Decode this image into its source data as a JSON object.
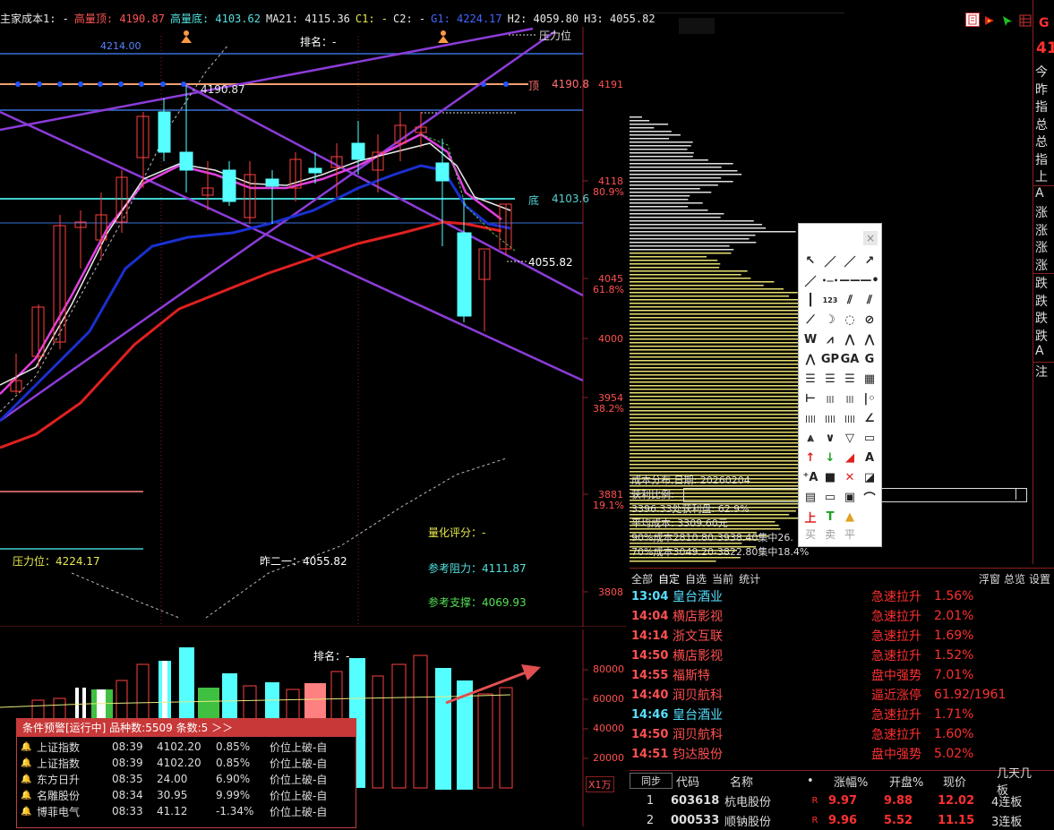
{
  "header": {
    "items": [
      {
        "text": "主家成本1: -",
        "color": "#e8e8e8"
      },
      {
        "text": "高量顶: 4190.87",
        "color": "#ff5555"
      },
      {
        "text": "高量底: 4103.62",
        "color": "#55e0e0"
      },
      {
        "text": "MA21: 4115.36",
        "color": "#e8e8e8"
      },
      {
        "text": "C1: -",
        "color": "#e8e850"
      },
      {
        "text": "C2: -",
        "color": "#e8e8e8"
      },
      {
        "text": "G1: 4224.17",
        "color": "#4466ff"
      },
      {
        "text": "H2: 4059.80",
        "color": "#e8e8e8"
      },
      {
        "text": "H3: 4055.82",
        "color": "#e8e8e8"
      }
    ]
  },
  "chart_labels": {
    "label_4214": "4214.00",
    "rank": "排名：-",
    "pressure_level": "压力位",
    "high_top_value": "4190.87",
    "top_label": "顶",
    "top_value": "4190.8",
    "bottom_label": "底",
    "bottom_value": "4103.6",
    "low_value": "4055.82",
    "quant_score": "量化评分：-",
    "ref_resistance": "参考阻力：4111.87",
    "ref_support": "参考支撑：4069.93",
    "pressure_bottom": "压力位：4224.17",
    "yesterday": "昨二一：4055.82",
    "vol_rank": "排名：-"
  },
  "price_axis": [
    {
      "v": "4191",
      "pct": ""
    },
    {
      "v": "4118",
      "pct": "80.9%"
    },
    {
      "v": "4045",
      "pct": "61.8%"
    },
    {
      "v": "4000",
      "pct": ""
    },
    {
      "v": "3954",
      "pct": "38.2%"
    },
    {
      "v": "3881",
      "pct": "19.1%"
    },
    {
      "v": "3808",
      "pct": ""
    }
  ],
  "vol_axis": [
    "80000",
    "60000",
    "40000",
    "20000",
    "X1万"
  ],
  "alert": {
    "title": "条件预警[运行中] 品种数:5509 条数:5 ＞＞",
    "rows": [
      {
        "name": "上证指数",
        "time": "08:39",
        "price": "4102.20",
        "pct": "0.85%",
        "msg": "价位上破-自"
      },
      {
        "name": "上证指数",
        "time": "08:39",
        "price": "4102.20",
        "pct": "0.85%",
        "msg": "价位上破-自"
      },
      {
        "name": "东方日升",
        "time": "08:35",
        "price": "24.00",
        "pct": "6.90%",
        "msg": "价位上破-自"
      },
      {
        "name": "名雕股份",
        "time": "08:34",
        "price": "30.95",
        "pct": "9.99%",
        "msg": "价位上破-自"
      },
      {
        "name": "博菲电气",
        "time": "08:33",
        "price": "41.12",
        "pct": "-1.34%",
        "msg": "价位上破-自"
      }
    ]
  },
  "cost_dist": {
    "date": "成本分布,日期: 20260204",
    "profit": "获利比例:",
    "profit_line": "3396.33处获利盘: 62.9%",
    "avg": "平均成本: 3309.60元",
    "c90": "90%成本2810.80-3938.40集中26.",
    "c70": "70%成本3049.20-3822.80集中18.4%"
  },
  "right_panel": {
    "top_code": "G",
    "price": "41",
    "labels": [
      "今",
      "昨",
      "指",
      "总",
      "总",
      "指",
      "上",
      "A",
      "涨",
      "涨",
      "涨",
      "涨",
      "跌",
      "跌",
      "跌",
      "跌",
      "A",
      "注"
    ]
  },
  "stock_tabs": {
    "left": [
      "全部",
      "自定",
      "自选",
      "当前",
      "统计"
    ],
    "right": [
      "浮窗",
      "总览",
      "设置"
    ]
  },
  "stocks": [
    {
      "time": "13:04",
      "name": "皇台酒业",
      "type": "急速拉升",
      "val": "1.56%",
      "blue": true
    },
    {
      "time": "14:04",
      "name": "横店影视",
      "type": "急速拉升",
      "val": "2.01%",
      "blue": false
    },
    {
      "time": "14:14",
      "name": "浙文互联",
      "type": "急速拉升",
      "val": "1.69%",
      "blue": false
    },
    {
      "time": "14:50",
      "name": "横店影视",
      "type": "急速拉升",
      "val": "1.52%",
      "blue": false
    },
    {
      "time": "14:55",
      "name": "福斯特",
      "type": "盘中强势",
      "val": "7.01%",
      "blue": false
    },
    {
      "time": "14:40",
      "name": "润贝航科",
      "type": "逼近涨停",
      "val": "61.92/1961",
      "blue": false
    },
    {
      "time": "14:46",
      "name": "皇台酒业",
      "type": "急速拉升",
      "val": "1.71%",
      "blue": true
    },
    {
      "time": "14:50",
      "name": "润贝航科",
      "type": "急速拉升",
      "val": "1.60%",
      "blue": false
    },
    {
      "time": "14:51",
      "name": "钧达股份",
      "type": "盘中强势",
      "val": "5.02%",
      "blue": false
    }
  ],
  "rank_header": [
    "同步",
    "代码",
    "名称",
    "•",
    "涨幅%",
    "开盘%",
    "现价",
    "几天几板"
  ],
  "ranks": [
    {
      "idx": "1",
      "code": "603618",
      "name": "杭电股份",
      "flag": "R",
      "chg": "9.97",
      "open": "9.88",
      "price": "12.02",
      "board": "4连板"
    },
    {
      "idx": "2",
      "code": "000533",
      "name": "顺钠股份",
      "flag": "R",
      "chg": "9.96",
      "open": "5.52",
      "price": "11.15",
      "board": "3连板"
    }
  ],
  "toolbox": {
    "close": "×",
    "rows": [
      [
        "cursor-icon",
        "line-icon",
        "ray-icon",
        "arrow-line-icon"
      ],
      [
        "segment-icon",
        "h-segment-icon",
        "h-line-icon",
        "h-ray-icon"
      ],
      [
        "v-line-icon",
        "number-icon",
        "parallel-icon",
        "parallel-channel-icon"
      ],
      [
        "pitchfork-icon",
        "arc-icon",
        "circle-icon",
        "cross-circle-icon"
      ],
      [
        "wave-w-icon",
        "wave-m-icon",
        "zigzag-icon",
        "zigzag2-icon"
      ],
      [
        "peak-icon",
        "gp-icon",
        "ga-icon",
        "g-icon"
      ],
      [
        "fib-retrace-icon",
        "fib-fan-icon",
        "fib-ext-icon",
        "gann-grid-icon"
      ],
      [
        "period-icon",
        "fib-period-icon",
        "cycle-icon",
        "ratio-line-icon"
      ],
      [
        "bars-icon",
        "bars2-icon",
        "bars3-icon",
        "angle-icon"
      ],
      [
        "fan-icon",
        "check-icon",
        "triangle-icon",
        "rectangle-icon"
      ],
      [
        "up-arrow-icon",
        "down-arrow-icon",
        "diag-arrow-icon",
        "text-icon"
      ],
      [
        "text-arrow-icon",
        "square-icon",
        "delete-icon",
        "highlight-icon"
      ],
      [
        "note-icon",
        "ruler-icon",
        "price-tag-icon",
        "curve-icon"
      ],
      [
        "up-mark-icon",
        "t-mark-icon",
        "light-icon",
        ""
      ]
    ],
    "bottom": [
      "买",
      "卖",
      "平"
    ],
    "glyphs": {
      "text-icon": "A",
      "text-arrow-icon": "⁺A",
      "number-icon": "123",
      "gp-icon": "GP",
      "ga-icon": "GA",
      "g-icon": "G",
      "up-mark-icon": "上",
      "t-mark-icon": "T"
    }
  }
}
